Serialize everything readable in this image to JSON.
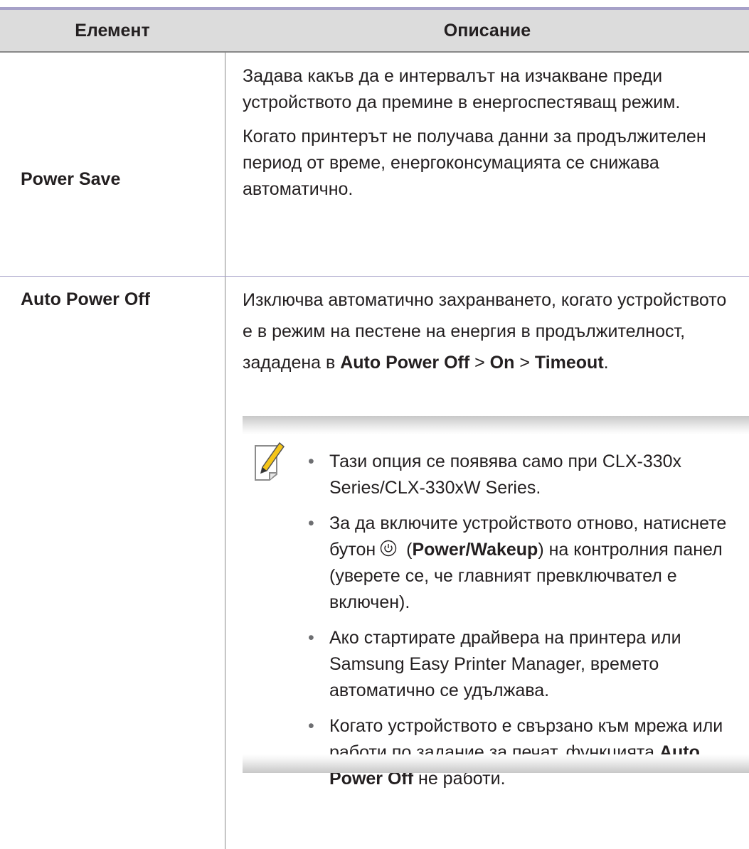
{
  "header": {
    "element_label": "Елемент",
    "description_label": "Описание"
  },
  "rows": [
    {
      "element": "Power Save",
      "paragraphs": [
        "Задава какъв да е интервалът на изчакване преди устройството да премине в енергоспестяващ режим.",
        "Когато принтерът не получава данни за продължителен период от време, енергоконсумацията се снижава автоматично."
      ]
    },
    {
      "element": "Auto Power Off",
      "description": {
        "text_before": "Изключва автоматично захранването, когато устройството е в режим на пестене на енергия в продължителност, зададена в ",
        "bold_1": "Auto Power Off",
        "sep_1": " > ",
        "bold_2": "On",
        "sep_2": " > ",
        "bold_3": "Timeout",
        "end": "."
      },
      "note": {
        "icon": "note-pencil-icon",
        "items": {
          "item1": "Тази опция се появява само при CLX-330x Series/CLX-330xW Series.",
          "item2_before": "За да включите устройството отново, натиснете бутон",
          "item2_icon": "power-button-icon",
          "item2_paren_open": " (",
          "item2_bold": "Power/Wakeup",
          "item2_after": ") на контролния панел (уверете се, че главният превключвател е включен).",
          "item3": "Ако стартирате драйвера на принтера или Samsung Easy Printer Manager, времето автоматично се удължава.",
          "item4_before": "Когато устройството е свързано към мрежа или работи по задание за печат, функцията ",
          "item4_bold": "Auto Power Off",
          "item4_after": " не работи."
        }
      }
    }
  ],
  "colors": {
    "rule": "#a6a1c8",
    "header_bg": "#dcdcdc",
    "text": "#231f20",
    "note_icon_accent": "#f5c518"
  }
}
